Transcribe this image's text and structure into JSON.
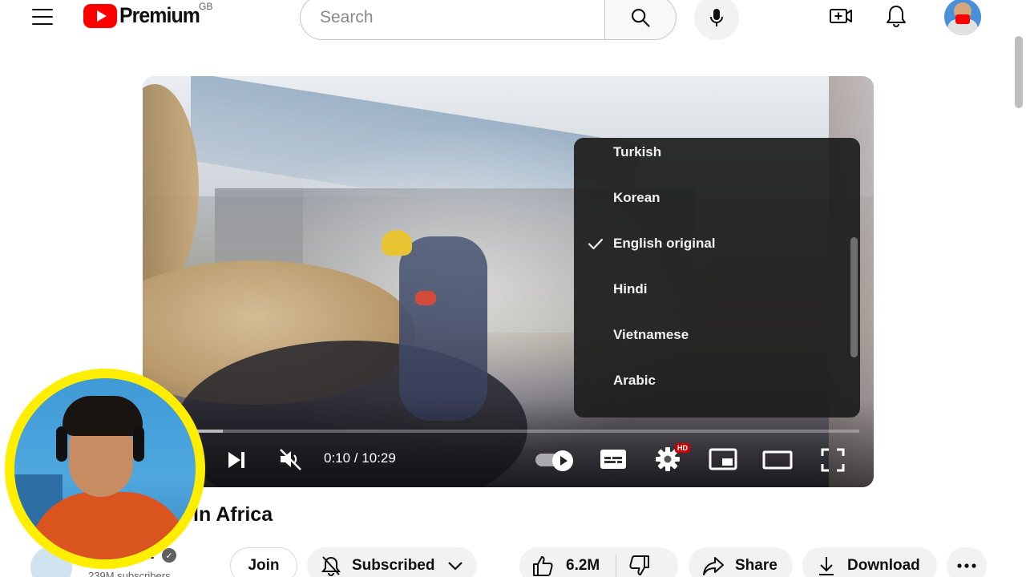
{
  "header": {
    "logo_text": "Premium",
    "region": "GB",
    "search_placeholder": "Search"
  },
  "player": {
    "current_time": "0:10",
    "duration": "10:29",
    "time_display": "0:10 / 10:29",
    "progress_played_fraction": 0.016,
    "progress_loaded_fraction": 0.1,
    "hd_badge": "HD",
    "audio_track_menu": {
      "items": [
        {
          "label": "Turkish",
          "selected": false
        },
        {
          "label": "Korean",
          "selected": false
        },
        {
          "label": "English original",
          "selected": true
        },
        {
          "label": "Hindi",
          "selected": false
        },
        {
          "label": "Vietnamese",
          "selected": false
        },
        {
          "label": "Arabic",
          "selected": false
        }
      ]
    }
  },
  "video": {
    "title_fragment": "In Africa",
    "channel_name_fragment": "t",
    "subscribers": "239M subscribers"
  },
  "actions": {
    "join": "Join",
    "subscribed": "Subscribed",
    "likes": "6.2M",
    "share": "Share",
    "download": "Download"
  },
  "colors": {
    "brand_red": "#ff0000",
    "webcam_ring": "#ffee00",
    "menu_bg": "#1c1c1c"
  }
}
